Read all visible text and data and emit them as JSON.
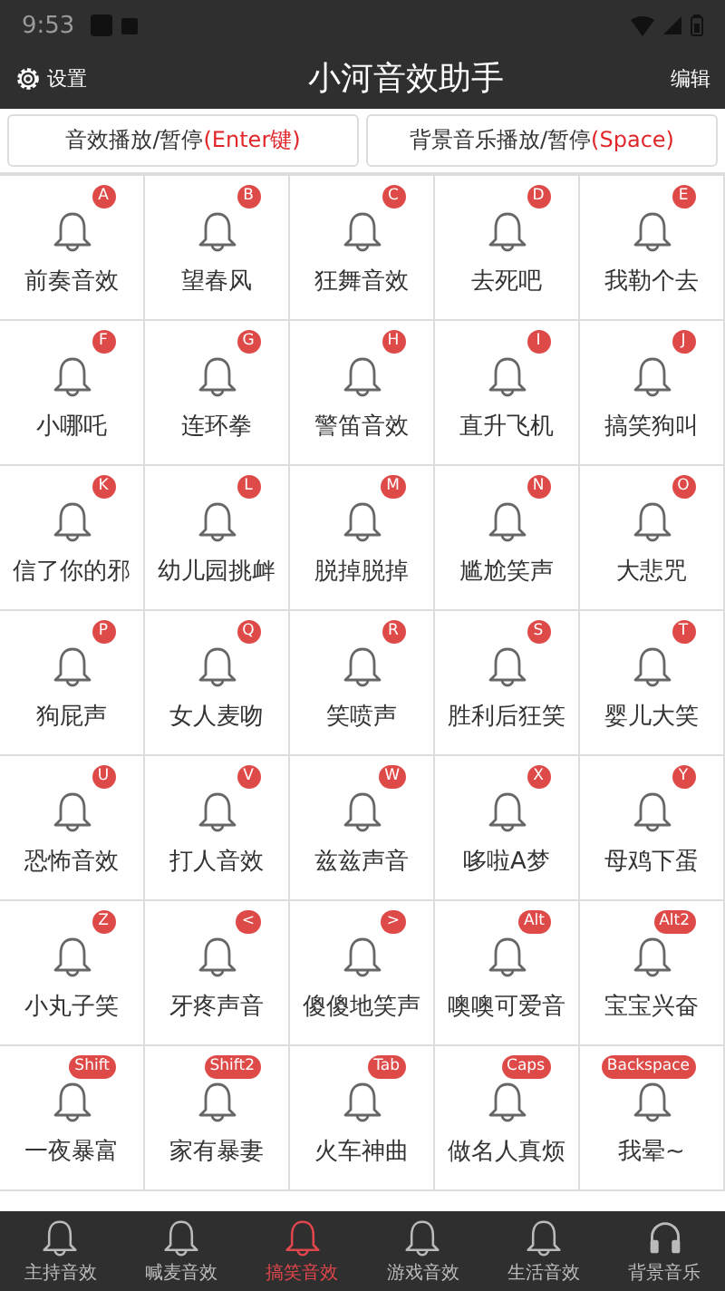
{
  "status_bar": {
    "time": "9:53"
  },
  "header": {
    "settings": "设置",
    "title": "小河音效助手",
    "edit": "编辑"
  },
  "controls": [
    {
      "label": "音效播放/暂停",
      "key": "(Enter键)"
    },
    {
      "label": "背景音乐播放/暂停",
      "key": "(Space)"
    }
  ],
  "sounds": [
    {
      "name": "前奏音效",
      "key": "A"
    },
    {
      "name": "望春风",
      "key": "B"
    },
    {
      "name": "狂舞音效",
      "key": "C"
    },
    {
      "name": "去死吧",
      "key": "D"
    },
    {
      "name": "我勒个去",
      "key": "E"
    },
    {
      "name": "小哪吒",
      "key": "F"
    },
    {
      "name": "连环拳",
      "key": "G"
    },
    {
      "name": "警笛音效",
      "key": "H"
    },
    {
      "name": "直升飞机",
      "key": "I"
    },
    {
      "name": "搞笑狗叫",
      "key": "J"
    },
    {
      "name": "信了你的邪",
      "key": "K"
    },
    {
      "name": "幼儿园挑衅",
      "key": "L"
    },
    {
      "name": "脱掉脱掉",
      "key": "M"
    },
    {
      "name": "尴尬笑声",
      "key": "N"
    },
    {
      "name": "大悲咒",
      "key": "O"
    },
    {
      "name": "狗屁声",
      "key": "P"
    },
    {
      "name": "女人麦吻",
      "key": "Q"
    },
    {
      "name": "笑喷声",
      "key": "R"
    },
    {
      "name": "胜利后狂笑",
      "key": "S"
    },
    {
      "name": "婴儿大笑",
      "key": "T"
    },
    {
      "name": "恐怖音效",
      "key": "U"
    },
    {
      "name": "打人音效",
      "key": "V"
    },
    {
      "name": "兹兹声音",
      "key": "W"
    },
    {
      "name": "哆啦A梦",
      "key": "X"
    },
    {
      "name": "母鸡下蛋",
      "key": "Y"
    },
    {
      "name": "小丸子笑",
      "key": "Z"
    },
    {
      "name": "牙疼声音",
      "key": "<"
    },
    {
      "name": "傻傻地笑声",
      "key": ">"
    },
    {
      "name": "噢噢可爱音",
      "key": "Alt"
    },
    {
      "name": "宝宝兴奋",
      "key": "Alt2"
    },
    {
      "name": "一夜暴富",
      "key": "Shift"
    },
    {
      "name": "家有暴妻",
      "key": "Shift2"
    },
    {
      "name": "火车神曲",
      "key": "Tab"
    },
    {
      "name": "做名人真烦",
      "key": "Caps"
    },
    {
      "name": "我晕~",
      "key": "Backspace"
    }
  ],
  "tabs": [
    {
      "label": "主持音效",
      "kind": "bell",
      "selected": false
    },
    {
      "label": "喊麦音效",
      "kind": "bell",
      "selected": false
    },
    {
      "label": "搞笑音效",
      "kind": "bell",
      "selected": true
    },
    {
      "label": "游戏音效",
      "kind": "bell",
      "selected": false
    },
    {
      "label": "生活音效",
      "kind": "bell",
      "selected": false
    },
    {
      "label": "背景音乐",
      "kind": "headphones",
      "selected": false
    }
  ]
}
